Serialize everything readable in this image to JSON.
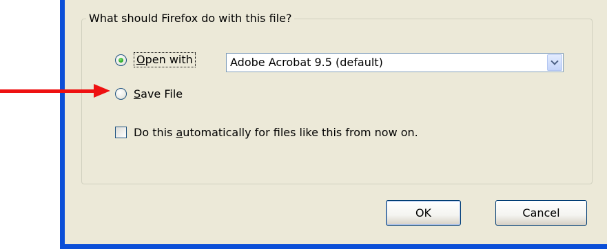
{
  "dialog": {
    "group_legend": "What should Firefox do with this file?",
    "open_with": {
      "label_prefix": "",
      "mnemonic": "O",
      "label_rest": "pen with",
      "selected": true
    },
    "app_select": {
      "value": "Adobe Acrobat 9.5 (default)"
    },
    "save_file": {
      "mnemonic": "S",
      "label_rest": "ave File",
      "selected": false
    },
    "auto_checkbox": {
      "label_before": "Do this ",
      "mnemonic": "a",
      "label_after": "utomatically for files like this from now on.",
      "checked": false
    },
    "ok_label": "OK",
    "cancel_label": "Cancel"
  },
  "colors": {
    "window_frame": "#0b4fd8",
    "dialog_bg": "#ece9d8",
    "annotation_arrow": "#ee1111",
    "radio_selected": "#21a121"
  },
  "icons": {
    "annotation": "red-arrow-icon",
    "dropdown": "chevron-down-icon"
  }
}
